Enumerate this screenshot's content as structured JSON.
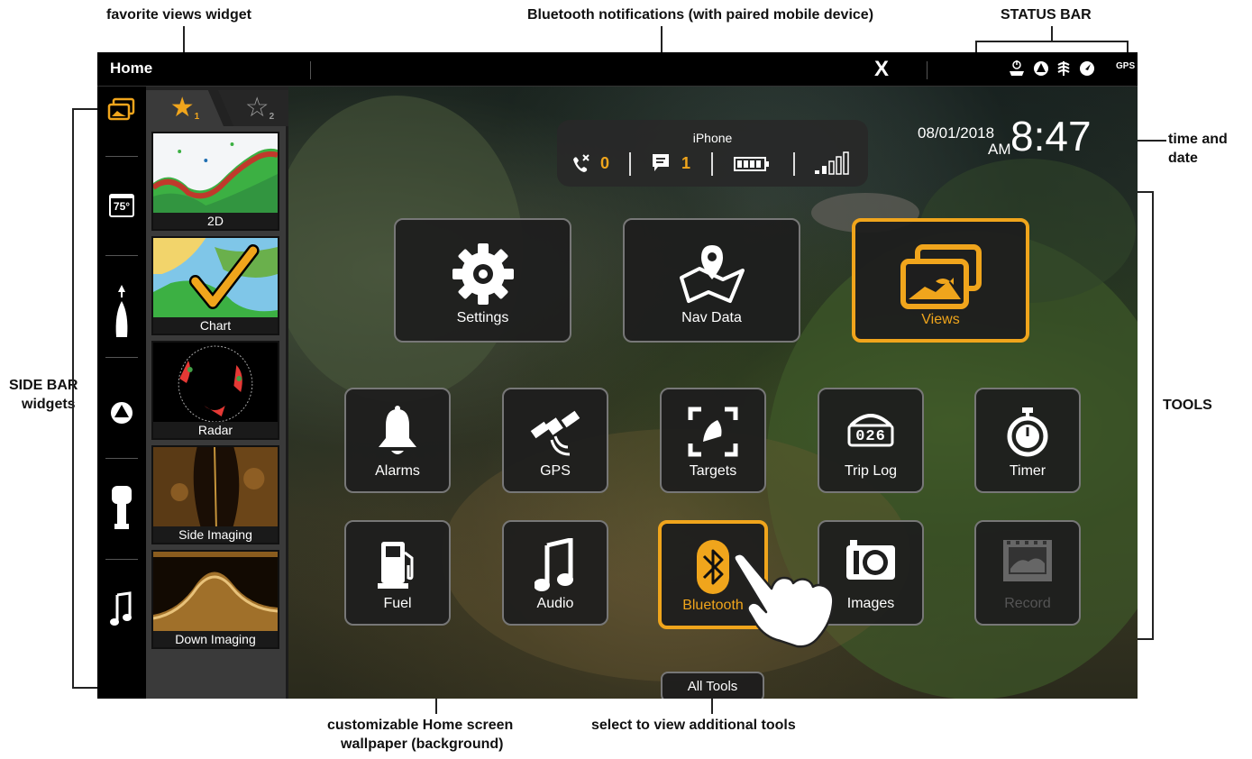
{
  "annotations": {
    "favorite_views_widget": "favorite views widget",
    "bluetooth_notifications": "Bluetooth notifications (with paired mobile device)",
    "status_bar": "STATUS BAR",
    "time_and_date_line1": "time and",
    "time_and_date_line2": "date",
    "side_bar_widgets_line1": "SIDE BAR",
    "side_bar_widgets_line2": "widgets",
    "tools": "TOOLS",
    "wallpaper_line1": "customizable Home screen",
    "wallpaper_line2": "wallpaper (background)",
    "all_tools_note": "select to view additional tools"
  },
  "status_bar": {
    "title": "Home",
    "logo": "X",
    "gps_label": "GPS"
  },
  "favorites": {
    "tab1_number": "1",
    "tab2_number": "2",
    "views": [
      {
        "label": "2D"
      },
      {
        "label": "Chart"
      },
      {
        "label": "Radar"
      },
      {
        "label": "Side Imaging"
      },
      {
        "label": "Down Imaging"
      }
    ]
  },
  "phone": {
    "device_name": "iPhone",
    "missed_calls": "0",
    "messages": "1"
  },
  "clock": {
    "date": "08/01/2018",
    "ampm": "AM",
    "time": "8:47"
  },
  "sidebar": {
    "temperature": "75°"
  },
  "tools": {
    "big": [
      {
        "label": "Settings"
      },
      {
        "label": "Nav Data"
      },
      {
        "label": "Views"
      }
    ],
    "row2": [
      {
        "label": "Alarms"
      },
      {
        "label": "GPS"
      },
      {
        "label": "Targets"
      },
      {
        "label": "Trip Log"
      },
      {
        "label": "Timer"
      }
    ],
    "row3": [
      {
        "label": "Fuel"
      },
      {
        "label": "Audio"
      },
      {
        "label": "Bluetooth"
      },
      {
        "label": "Images"
      },
      {
        "label": "Record"
      }
    ],
    "trip_log_digits": "026",
    "all_tools_label": "All Tools"
  },
  "colors": {
    "accent": "#f0a51c",
    "panel": "#1e1e1e",
    "screen_bg": "#000000"
  }
}
